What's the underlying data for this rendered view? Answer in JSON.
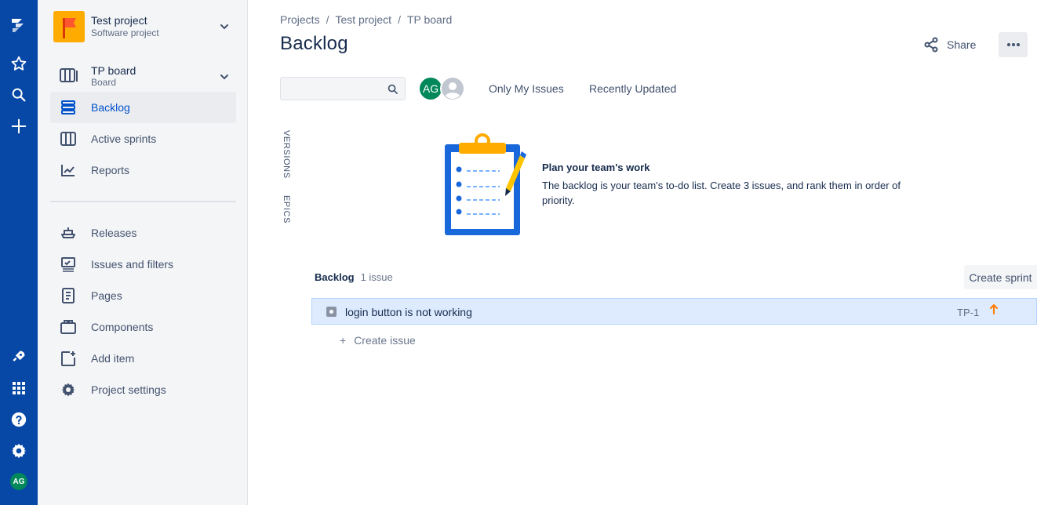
{
  "global_nav": {
    "user_initials": "AG",
    "icons": [
      "jira-logo-icon",
      "star-icon",
      "search-icon",
      "plus-icon",
      "rocket-icon",
      "app-switcher-icon",
      "help-icon",
      "settings-icon"
    ]
  },
  "sidebar": {
    "project_name": "Test project",
    "project_type": "Software project",
    "board_name": "TP board",
    "board_type": "Board",
    "items": [
      {
        "label": "Backlog",
        "icon": "backlog-icon",
        "active": true
      },
      {
        "label": "Active sprints",
        "icon": "board-columns-icon",
        "active": false
      },
      {
        "label": "Reports",
        "icon": "chart-icon",
        "active": false
      }
    ],
    "secondary_items": [
      {
        "label": "Releases",
        "icon": "ship-icon"
      },
      {
        "label": "Issues and filters",
        "icon": "issues-icon"
      },
      {
        "label": "Pages",
        "icon": "page-icon"
      },
      {
        "label": "Components",
        "icon": "component-icon"
      },
      {
        "label": "Add item",
        "icon": "add-item-icon"
      },
      {
        "label": "Project settings",
        "icon": "gear-icon"
      }
    ]
  },
  "breadcrumb": [
    "Projects",
    "Test project",
    "TP board"
  ],
  "page_title": "Backlog",
  "header_actions": {
    "share_label": "Share"
  },
  "filters": {
    "search_value": "",
    "avatar_initials": "AG",
    "quick_filters": [
      "Only My Issues",
      "Recently Updated"
    ]
  },
  "side_tabs": [
    "VERSIONS",
    "EPICS"
  ],
  "empty_state": {
    "title": "Plan your team's work",
    "description": "The backlog is your team's to-do list. Create 3 issues, and rank them in order of priority."
  },
  "backlog": {
    "title": "Backlog",
    "count_label": "1 issue",
    "create_sprint_label": "Create sprint",
    "issues": [
      {
        "summary": "login button is not working",
        "key": "TP-1",
        "priority": "high"
      }
    ],
    "create_issue_label": "Create issue"
  },
  "colors": {
    "nav_blue": "#0747a6",
    "accent": "#0052cc",
    "avatar_green": "#00875a",
    "selected_row": "#deebff",
    "priority_orange": "#ff7a00"
  }
}
